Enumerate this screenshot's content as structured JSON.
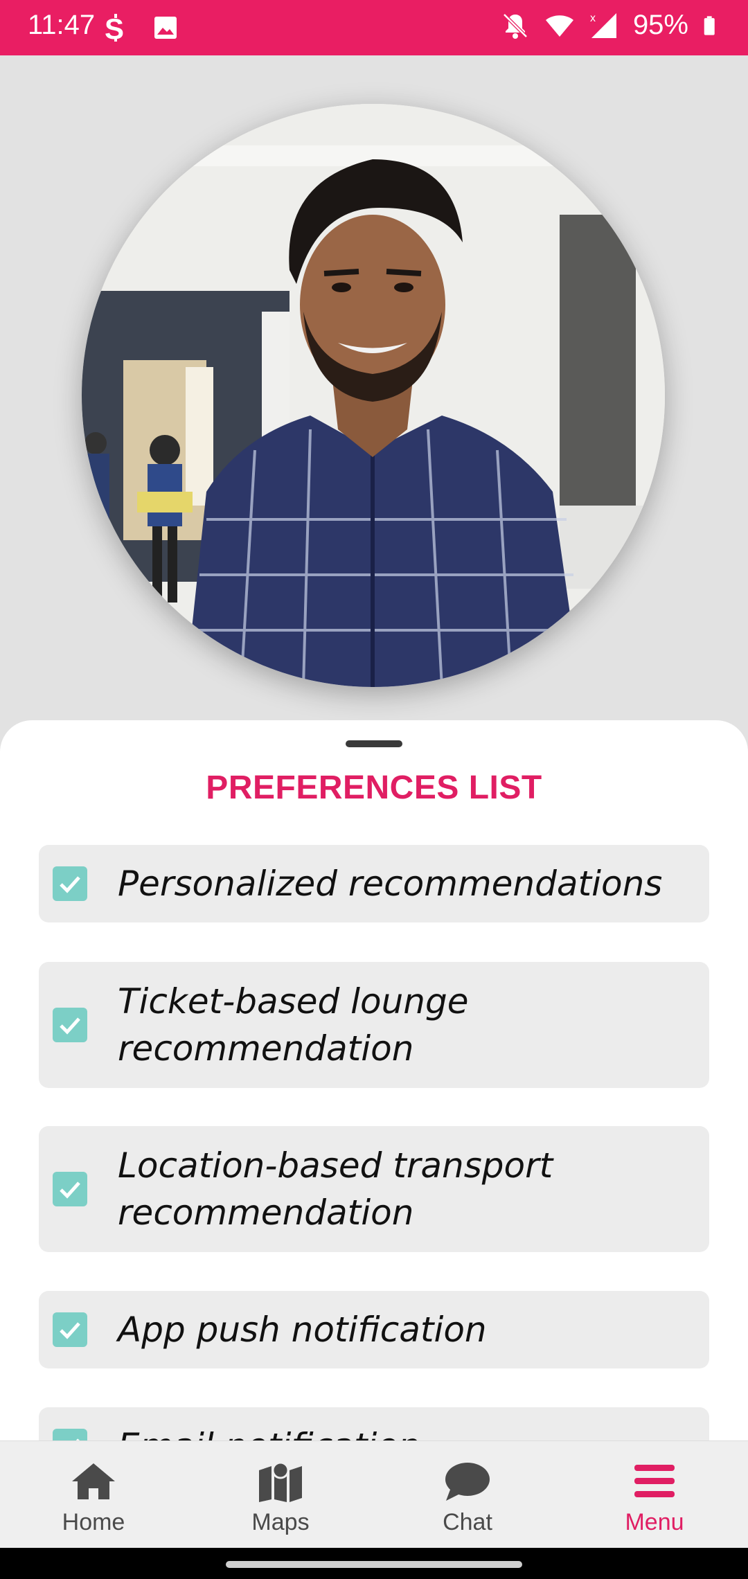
{
  "status_bar": {
    "time": "11:47",
    "battery": "95%",
    "color": "#e91e63"
  },
  "profile": {
    "avatar_icon": "profile-photo"
  },
  "preferences": {
    "title": "PREFERENCES LIST",
    "items": [
      {
        "label": "Personalized recommendations",
        "checked": true
      },
      {
        "label": "Ticket-based lounge recommendation",
        "checked": true
      },
      {
        "label": "Location-based transport recommendation",
        "checked": true
      },
      {
        "label": "App push notification",
        "checked": true
      },
      {
        "label": "Email notification",
        "checked": true
      }
    ]
  },
  "nav": {
    "items": [
      {
        "label": "Home",
        "icon": "home-icon"
      },
      {
        "label": "Maps",
        "icon": "map-icon"
      },
      {
        "label": "Chat",
        "icon": "chat-icon"
      },
      {
        "label": "Menu",
        "icon": "menu-icon",
        "active": true
      }
    ],
    "accent": "#e01e63"
  }
}
